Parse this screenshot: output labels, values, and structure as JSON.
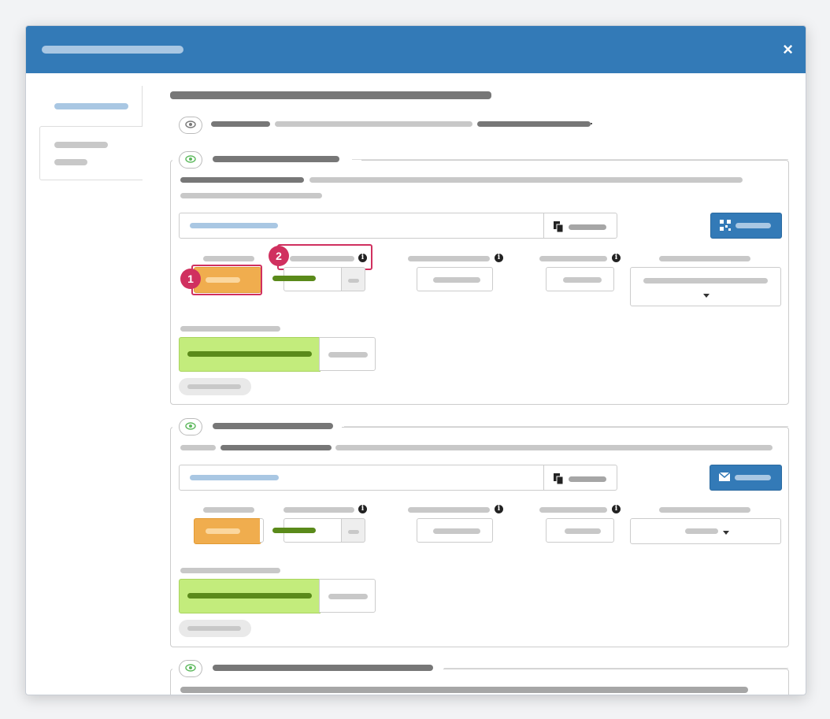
{
  "badges": {
    "one": "1",
    "two": "2"
  },
  "header": {
    "close_glyph": "×"
  },
  "icons": {
    "close": "close-icon",
    "eye": "eye-icon",
    "copy": "copy-icon",
    "qr": "qrcode-icon",
    "mail": "envelope-icon",
    "info": "info-icon",
    "caret": "caret-down-icon"
  },
  "colors": {
    "header": "#337ab7",
    "primary_button": "#337ab7",
    "warning_button": "#f0ad4e",
    "success_field": "#c3ec7c",
    "success_text": "#5a8a1a",
    "callout": "#d0305f"
  }
}
